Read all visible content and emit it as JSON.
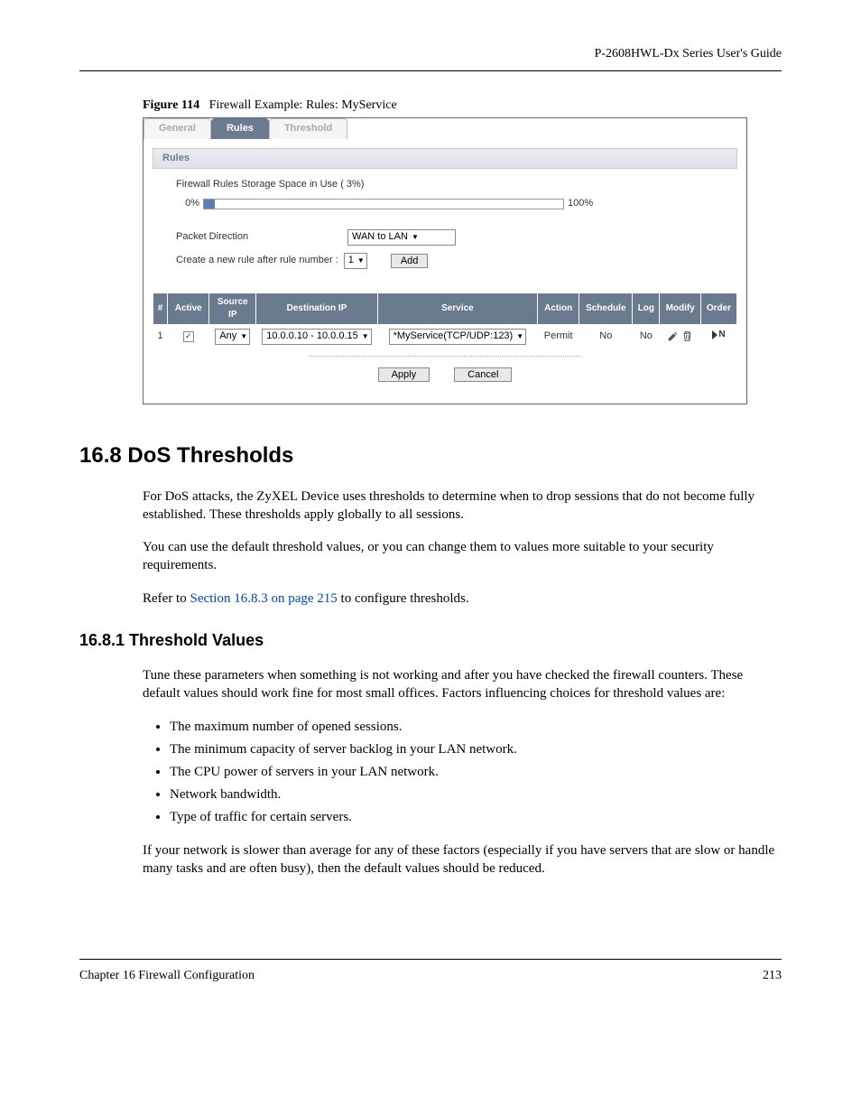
{
  "header": {
    "guide_title": "P-2608HWL-Dx Series User's Guide"
  },
  "figure": {
    "prefix": "Figure 114",
    "caption": "Firewall Example: Rules: MyService",
    "tabs": {
      "general": "General",
      "rules": "Rules",
      "threshold": "Threshold"
    },
    "section_title": "Rules",
    "storage_label": "Firewall Rules Storage Space in Use  ( 3%)",
    "progress": {
      "left": "0%",
      "right": "100%"
    },
    "packet_direction_label": "Packet Direction",
    "packet_direction_value": "WAN to LAN",
    "create_rule_label": "Create a new rule after rule number :",
    "create_rule_value": "1",
    "add_button": "Add",
    "columns": [
      "#",
      "Active",
      "Source IP",
      "Destination IP",
      "Service",
      "Action",
      "Schedule",
      "Log",
      "Modify",
      "Order"
    ],
    "row1": {
      "num": "1",
      "source_ip": "Any",
      "dest_ip": "10.0.0.10 - 10.0.0.15",
      "service": "*MyService(TCP/UDP:123)",
      "action": "Permit",
      "schedule": "No",
      "log": "No",
      "order": "N"
    },
    "apply_button": "Apply",
    "cancel_button": "Cancel"
  },
  "section_16_8": {
    "heading": "16.8  DoS Thresholds",
    "p1": "For DoS attacks, the ZyXEL Device uses thresholds to determine when to drop sessions that do not become fully established. These thresholds apply globally to all sessions.",
    "p2": "You can use the default threshold values, or you can change them to values more suitable to your security requirements.",
    "p3_prefix": "Refer to ",
    "p3_link": "Section 16.8.3 on page 215",
    "p3_suffix": " to configure thresholds."
  },
  "section_16_8_1": {
    "heading": "16.8.1  Threshold Values",
    "p1": "Tune these parameters when something is not working and after you have checked the firewall counters. These default values should work fine for most small offices. Factors influencing choices for threshold values are:",
    "bullets": [
      "The maximum number of opened sessions.",
      "The minimum capacity of server backlog in your LAN network.",
      "The CPU power of servers in your LAN network.",
      "Network bandwidth.",
      "Type of traffic for certain servers."
    ],
    "p2": "If your network is slower than average for any of these factors (especially if you have servers that are slow or handle many tasks and are often busy), then the default values should be reduced."
  },
  "footer": {
    "left": "Chapter 16 Firewall Configuration",
    "right": "213"
  }
}
